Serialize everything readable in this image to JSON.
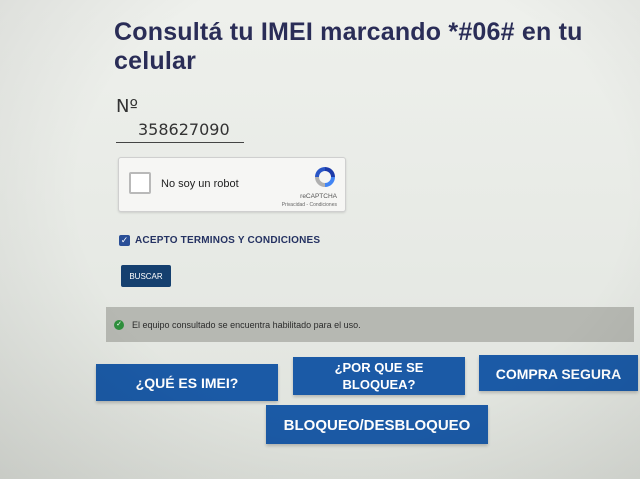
{
  "header": {
    "title": "Consultá tu IMEI marcando *#06# en tu celular"
  },
  "imei": {
    "label": "Nº",
    "value": "358627090"
  },
  "captcha": {
    "label": "No soy un robot",
    "brand": "reCAPTCHA",
    "links": "Privacidad - Condiciones",
    "checked": false
  },
  "terms": {
    "label": "ACEPTO TERMINOS Y CONDICIONES",
    "checked": true
  },
  "search_button": {
    "label": "BUSCAR"
  },
  "alert": {
    "text": "El equipo consultado se encuentra habilitado para el uso.",
    "status": "success"
  },
  "nav": {
    "que_es_imei": "¿QUÉ ES IMEI?",
    "por_que_line1": "¿POR QUE SE",
    "por_que_line2": "BLOQUEA?",
    "compra_segura": "COMPRA SEGURA",
    "bloqueo": "BLOQUEO/DESBLOQUEO"
  },
  "colors": {
    "title": "#2a2d57",
    "button_primary": "#1b5aa6",
    "search_button": "#15406f",
    "alert_bg": "#b6b8b2",
    "success": "#2e8f3c"
  }
}
